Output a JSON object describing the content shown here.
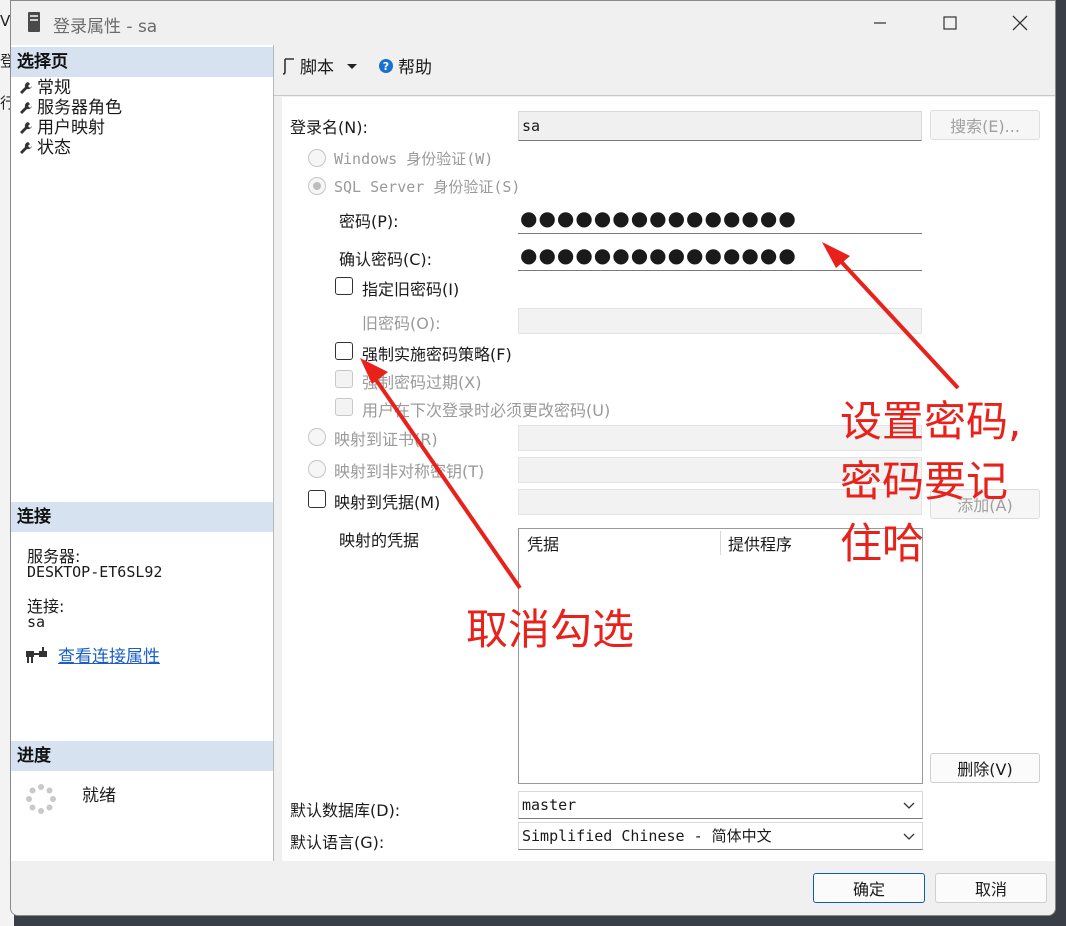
{
  "window": {
    "title": "登录属性 - sa"
  },
  "left": {
    "select_page_header": "选择页",
    "nav": [
      "常规",
      "服务器角色",
      "用户映射",
      "状态"
    ],
    "connection_header": "连接",
    "server_label": "服务器:",
    "server_value": "DESKTOP-ET6SL92",
    "connection_label": "连接:",
    "connection_value": "sa",
    "view_props_link": "查看连接属性",
    "progress_header": "进度",
    "progress_status": "就绪"
  },
  "toolbar": {
    "script_label": "脚本",
    "help_label": "帮助"
  },
  "form": {
    "login_name_label": "登录名(N):",
    "login_name_value": "sa",
    "search_button": "搜索(E)...",
    "windows_auth": "Windows 身份验证(W)",
    "sql_auth": "SQL Server 身份验证(S)",
    "password_label": "密码(P):",
    "password_value": "●●●●●●●●●●●●●●●",
    "confirm_label": "确认密码(C):",
    "confirm_value": "●●●●●●●●●●●●●●●",
    "specify_old_password": "指定旧密码(I)",
    "old_password_label": "旧密码(O):",
    "enforce_policy": "强制实施密码策略(F)",
    "enforce_expiration": "强制密码过期(X)",
    "must_change": "用户在下次登录时必须更改密码(U)",
    "map_cert": "映射到证书(R)",
    "map_asym_key": "映射到非对称密钥(T)",
    "map_credential": "映射到凭据(M)",
    "add_button": "添加(A)",
    "mapped_credentials_label": "映射的凭据",
    "grid_headers": [
      "凭据",
      "提供程序"
    ],
    "remove_button": "删除(V)",
    "default_db_label": "默认数据库(D):",
    "default_db_value": "master",
    "default_lang_label": "默认语言(G):",
    "default_lang_value": "Simplified Chinese - 简体中文"
  },
  "footer": {
    "ok_button": "确定",
    "cancel_button": "取消"
  },
  "annotations": {
    "password_note_lines": [
      "设置密码,",
      "密码要记",
      "住哈"
    ],
    "uncheck_note": "取消勾选",
    "color": "#e8211b"
  },
  "bg_app_glyphs": [
    "V",
    "登",
    "行"
  ]
}
